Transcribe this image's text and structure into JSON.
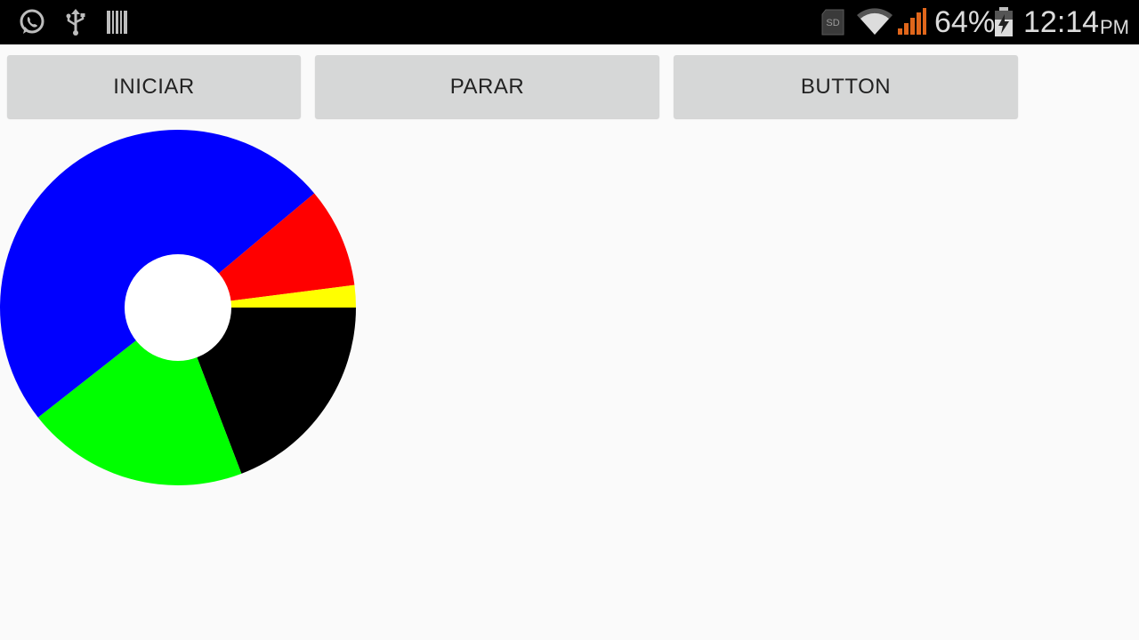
{
  "status_bar": {
    "left_icons": [
      "whatsapp-icon",
      "usb-icon",
      "barcode-icon"
    ],
    "right_icons": [
      "sd-card-icon",
      "wifi-icon",
      "cell-signal-icon",
      "battery-charging-icon"
    ],
    "sd_label": "SD",
    "battery_percent": "64%",
    "time": "12:14",
    "ampm": "PM",
    "signal_color": "#e0661b"
  },
  "buttons": {
    "iniciar": "INICIAR",
    "parar": "PARAR",
    "button": "BUTTON"
  },
  "chart_data": {
    "type": "pie",
    "donut": true,
    "slices": [
      {
        "color": "#000000",
        "value": 19
      },
      {
        "color": "#00ff00",
        "value": 20
      },
      {
        "color": "#0000ff",
        "value": 49
      },
      {
        "color": "#ff0000",
        "value": 9
      },
      {
        "color": "#ffff00",
        "value": 2
      }
    ],
    "start_angle_deg": 0,
    "hole_color": "#ffffff"
  }
}
